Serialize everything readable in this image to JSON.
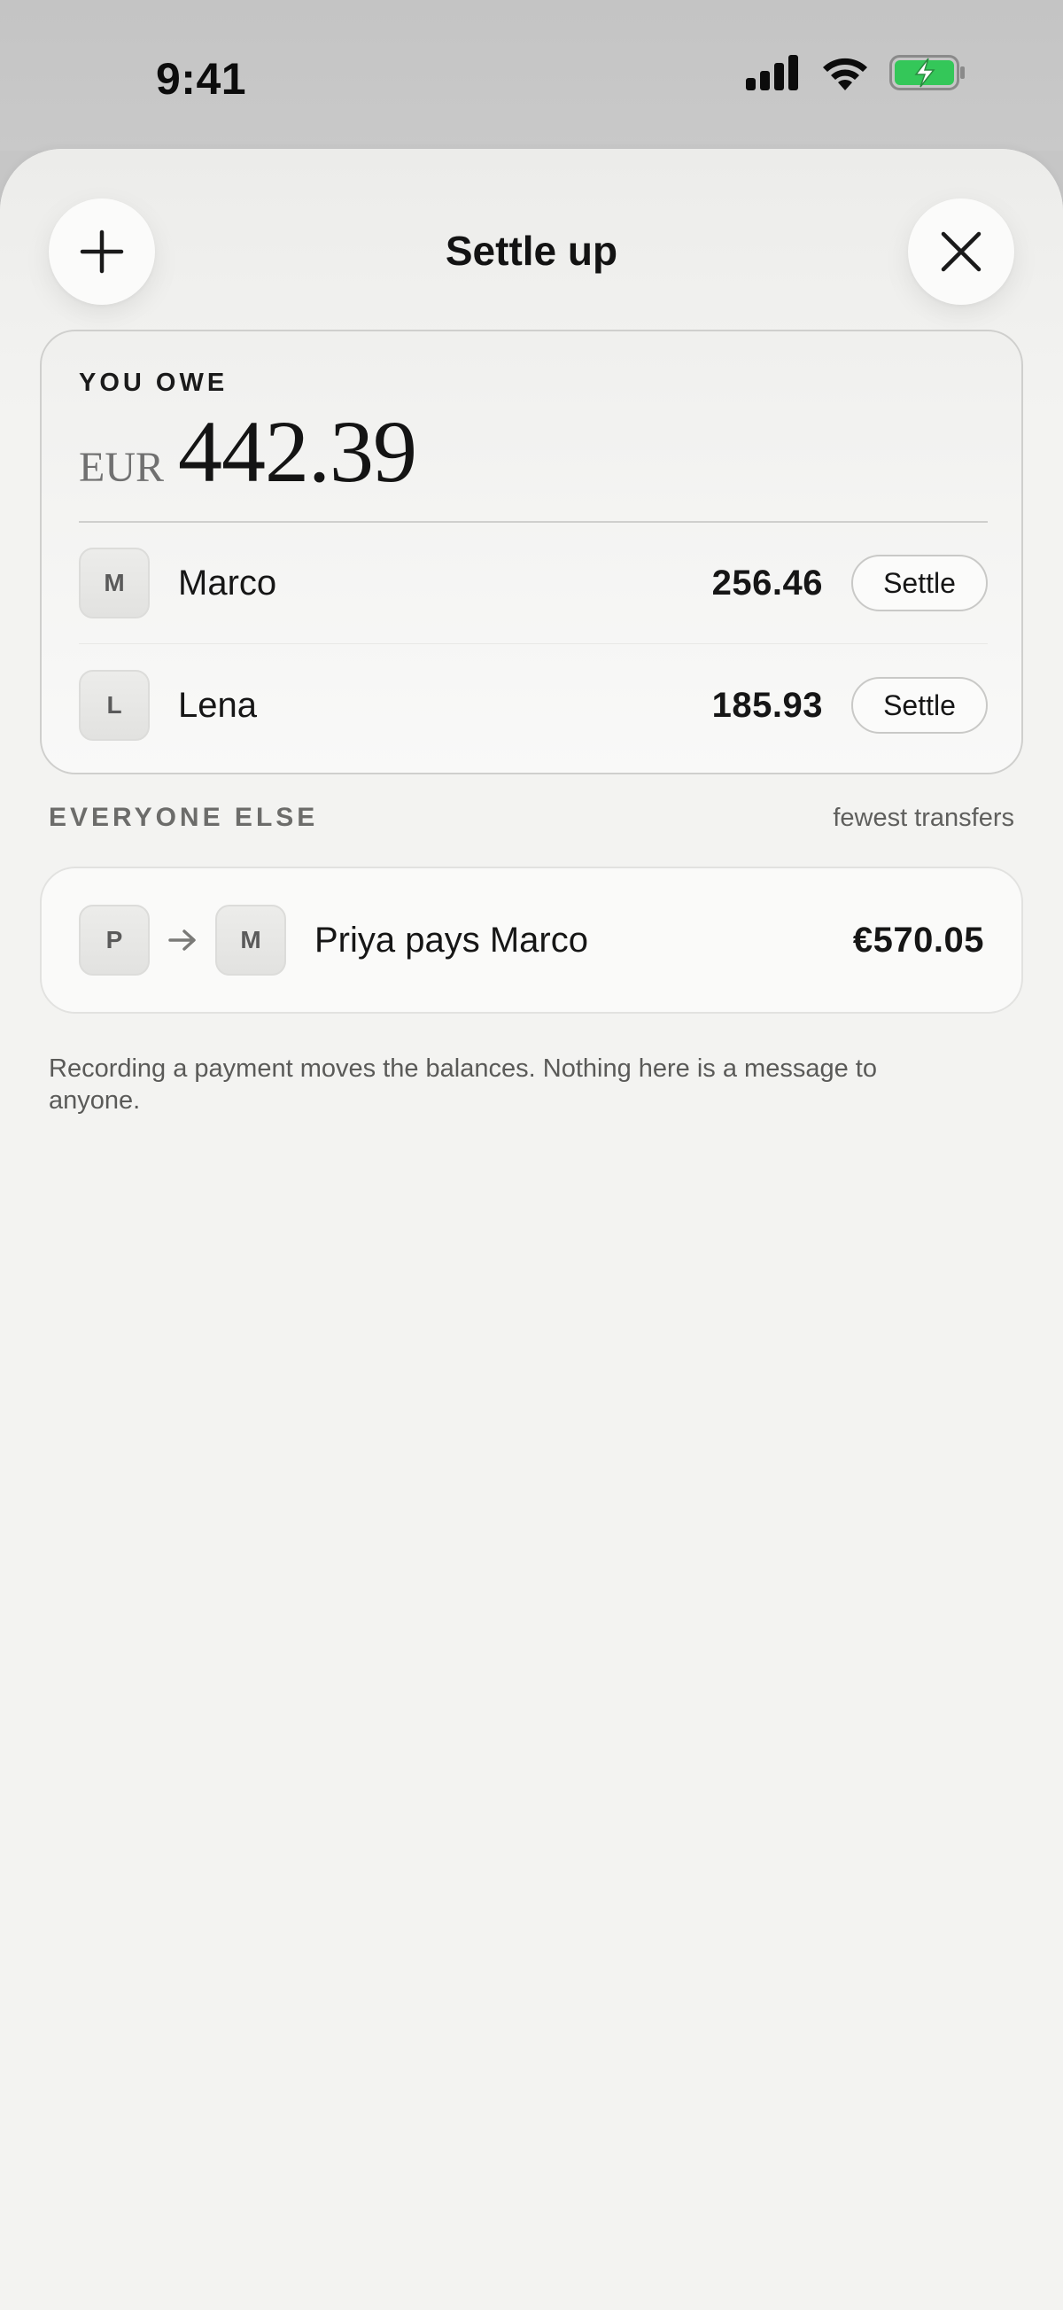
{
  "status_bar": {
    "time": "9:41",
    "icons": [
      "signal-icon",
      "wifi-icon",
      "battery-charging-icon"
    ],
    "battery_color": "#34c759"
  },
  "header": {
    "title": "Settle up",
    "left_button_icon": "plus-icon",
    "right_button_icon": "close-icon"
  },
  "you_owe": {
    "label": "YOU OWE",
    "currency": "EUR",
    "total": "442.39",
    "people": [
      {
        "initial": "M",
        "name": "Marco",
        "amount": "256.46",
        "action": "Settle"
      },
      {
        "initial": "L",
        "name": "Lena",
        "amount": "185.93",
        "action": "Settle"
      }
    ]
  },
  "everyone_else": {
    "title": "EVERYONE ELSE",
    "hint": "fewest transfers",
    "transfers": [
      {
        "from_initial": "P",
        "to_initial": "M",
        "text": "Priya pays Marco",
        "amount": "€570.05"
      }
    ]
  },
  "footnote": "Recording a payment moves the balances. Nothing here is a message to anyone."
}
